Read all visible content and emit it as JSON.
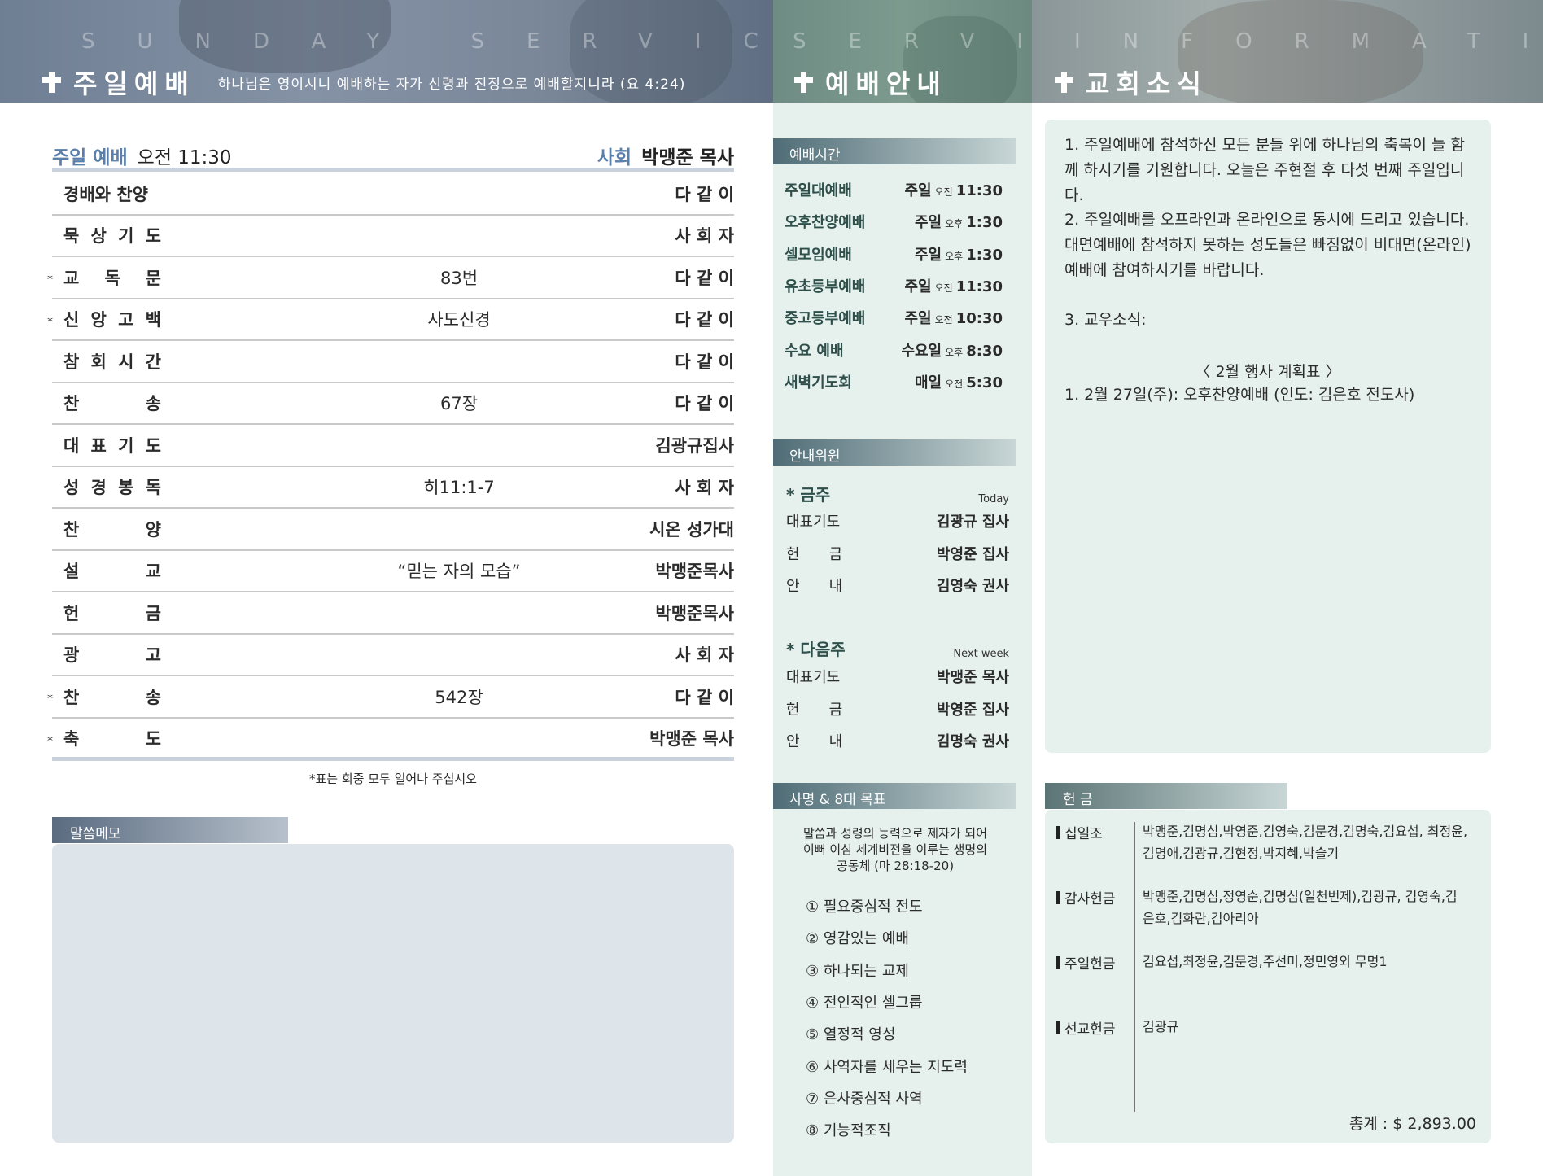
{
  "banners": {
    "sunday": {
      "watermark": "SUNDAY SERVICE",
      "title": "주일예배",
      "verse": "하나님은 영이시니 예배하는 자가 신령과 진정으로 예배할지니라 (요 4:24)"
    },
    "service": {
      "watermark": "SERVICE",
      "title": "예배안내"
    },
    "info": {
      "watermark": "INFORMATION",
      "title": "교회소식"
    }
  },
  "sunday_service": {
    "header_label": "주일 예배",
    "header_time": "오전 11:30",
    "presider_label": "사회",
    "presider_name": "박맹준 목사",
    "order": [
      {
        "star": "",
        "name": [
          "경배와 찬양"
        ],
        "item": "",
        "who": "다 같 이"
      },
      {
        "star": "",
        "name": [
          "묵",
          "상",
          "기",
          "도"
        ],
        "item": "",
        "who": "사 회 자"
      },
      {
        "star": "*",
        "name": [
          "교",
          "독",
          "문"
        ],
        "item": "83번",
        "who": "다 같 이"
      },
      {
        "star": "*",
        "name": [
          "신",
          "앙",
          "고",
          "백"
        ],
        "item": "사도신경",
        "who": "다 같 이"
      },
      {
        "star": "",
        "name": [
          "참",
          "회",
          "시",
          "간"
        ],
        "item": "",
        "who": "다 같 이"
      },
      {
        "star": "",
        "name": [
          "찬",
          "송"
        ],
        "item": "67장",
        "who": "다 같 이"
      },
      {
        "star": "",
        "name": [
          "대",
          "표",
          "기",
          "도"
        ],
        "item": "",
        "who": "김광규집사"
      },
      {
        "star": "",
        "name": [
          "성",
          "경",
          "봉",
          "독"
        ],
        "item": "히11:1-7",
        "who": "사 회 자"
      },
      {
        "star": "",
        "name": [
          "찬",
          "양"
        ],
        "item": "",
        "who": "시온 성가대"
      },
      {
        "star": "",
        "name": [
          "설",
          "교"
        ],
        "item": "“믿는 자의 모습”",
        "who": "박맹준목사"
      },
      {
        "star": "",
        "name": [
          "헌",
          "금"
        ],
        "item": "",
        "who": "박맹준목사"
      },
      {
        "star": "",
        "name": [
          "광",
          "고"
        ],
        "item": "",
        "who": "사 회 자"
      },
      {
        "star": "*",
        "name": [
          "찬",
          "송"
        ],
        "item": "542장",
        "who": "다 같 이"
      },
      {
        "star": "*",
        "name": [
          "축",
          "도"
        ],
        "item": "",
        "who": "박맹준 목사"
      }
    ],
    "note": "*표는 회중 모두 일어나 주십시오",
    "memo_label": "말씀메모"
  },
  "service_info": {
    "times_label": "예배시간",
    "times": [
      {
        "name": "주일대예배",
        "day": "주일",
        "ampm": "오전",
        "time": "11:30"
      },
      {
        "name": "오후찬양예배",
        "day": "주일",
        "ampm": "오후",
        "time": "1:30"
      },
      {
        "name": "셀모임예배",
        "day": "주일",
        "ampm": "오후",
        "time": "1:30"
      },
      {
        "name": "유초등부예배",
        "day": "주일",
        "ampm": "오전",
        "time": "11:30"
      },
      {
        "name": "중고등부예배",
        "day": "주일",
        "ampm": "오전",
        "time": "10:30"
      },
      {
        "name": "수요 예배",
        "day": "수요일",
        "ampm": "오후",
        "time": "8:30"
      },
      {
        "name": "새벽기도회",
        "day": "매일",
        "ampm": "오전",
        "time": "5:30"
      }
    ],
    "ushers_label": "안내위원",
    "this_week": {
      "label": "* 금주",
      "en": "Today",
      "rows": [
        {
          "role": [
            "대표기도"
          ],
          "person": "김광규 집사"
        },
        {
          "role": [
            "헌",
            "금"
          ],
          "person": "박영준 집사"
        },
        {
          "role": [
            "안",
            "내"
          ],
          "person": "김영숙 권사"
        }
      ]
    },
    "next_week": {
      "label": "* 다음주",
      "en": "Next week",
      "rows": [
        {
          "role": [
            "대표기도"
          ],
          "person": "박맹준 목사"
        },
        {
          "role": [
            "헌",
            "금"
          ],
          "person": "박영준 집사"
        },
        {
          "role": [
            "안",
            "내"
          ],
          "person": "김명숙 권사"
        }
      ]
    },
    "mission_label": "사명 & 8대 목표",
    "mission_text": [
      "말씀과 성령의 능력으로 제자가 되어",
      "이뻐 이심 세계비전을 이루는 생명의",
      "공동체 (마 28:18-20)"
    ],
    "goals": [
      "① 필요중심적 전도",
      "② 영감있는 예배",
      "③ 하나되는 교제",
      "④ 전인적인 셀그룹",
      "⑤ 열정적 영성",
      "⑥ 사역자를 세우는 지도력",
      "⑦ 은사중심적 사역",
      "⑧ 기능적조직"
    ]
  },
  "church_news": {
    "p1": "1. 주일예배에 참석하신 모든 분들 위에 하나님의 축복이 늘 함께 하시기를 기원합니다. 오늘은 주현절 후 다섯 번째 주일입니다.",
    "p2": "2. 주일예배를 오프라인과 온라인으로 동시에 드리고 있습니다. 대면예배에 참석하지 못하는 성도들은 빠짐없이 비대면(온라인)예배에 참여하시기를 바랍니다.",
    "p3": "3. 교우소식:",
    "plan_title": "〈  2월 행사 계획표  〉",
    "plan_item": "1. 2월 27일(주): 오후찬양예배 (인도: 김은호 전도사)"
  },
  "offering": {
    "label": "헌 금",
    "rows": [
      {
        "type": "십일조",
        "names": "박맹준,김명심,박영준,김영숙,김문경,김명숙,김요섭, 최정윤,김명애,김광규,김현정,박지혜,박슬기"
      },
      {
        "type": "감사헌금",
        "names": "박맹준,김명심,정영순,김명심(일천번제),김광규, 김영숙,김은호,김화란,김아리아"
      },
      {
        "type": "주일헌금",
        "names": "김요섭,최정윤,김문경,주선미,정민영외 무명1"
      },
      {
        "type": "선교헌금",
        "names": "김광규"
      }
    ],
    "total": "총계 : $ 2,893.00"
  },
  "colors": {
    "accent_blue": "#5a7faa",
    "mint_bg": "#e6f1ee",
    "memo_bg": "#dde4ea"
  }
}
